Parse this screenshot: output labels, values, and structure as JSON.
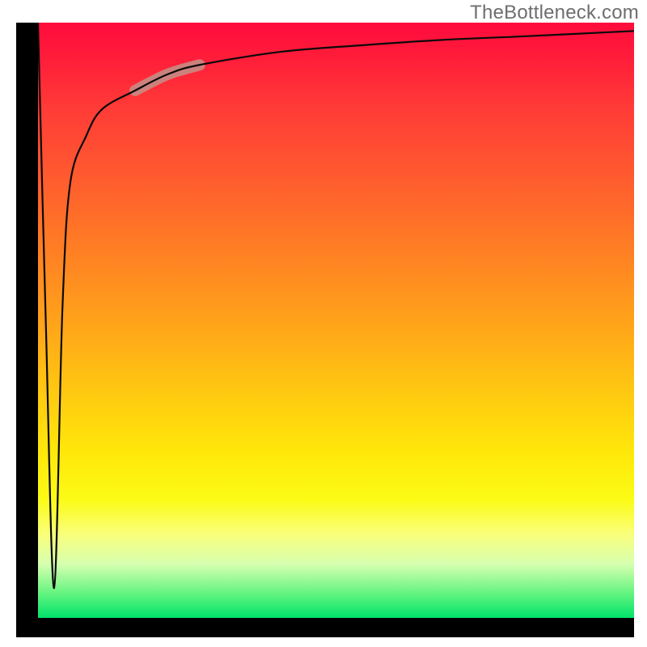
{
  "watermark": {
    "text": "TheBottleneck.com"
  },
  "colors": {
    "frame": "#000000",
    "curve": "#0a0a0a",
    "highlight": "#c88a82",
    "gradient_stops": [
      "#ff0b3d",
      "#ff1d3a",
      "#ff3a37",
      "#ff5b2f",
      "#ff7e24",
      "#ffa21a",
      "#ffc811",
      "#ffe70a",
      "#fbfb14",
      "#f9ff7b",
      "#d6ffb0",
      "#61f47f",
      "#00e36b"
    ]
  },
  "chart_data": {
    "type": "line",
    "title": "",
    "xlabel": "",
    "ylabel": "",
    "xlim": [
      0,
      100
    ],
    "ylim": [
      0,
      100
    ],
    "grid": false,
    "legend": false,
    "note": "Curve traced from pixels. Values are percent of plot width/height; x increases rightward, y increases upward. The curve starts at the top-left, dives to the bottom, then rises logarithmically toward the top-right.",
    "series": [
      {
        "name": "curve",
        "x": [
          0,
          1.3,
          2.7,
          4.1,
          5.4,
          8.1,
          10.8,
          16.3,
          21.7,
          27.1,
          40.7,
          54.3,
          67.8,
          81.4,
          100
        ],
        "y": [
          100,
          50,
          5,
          52,
          73,
          81,
          85.5,
          88.6,
          91.3,
          92.9,
          95.1,
          96.2,
          97.1,
          97.7,
          98.6
        ]
      }
    ],
    "highlight_segment": {
      "x_start": 16.3,
      "x_end": 27.1
    }
  }
}
